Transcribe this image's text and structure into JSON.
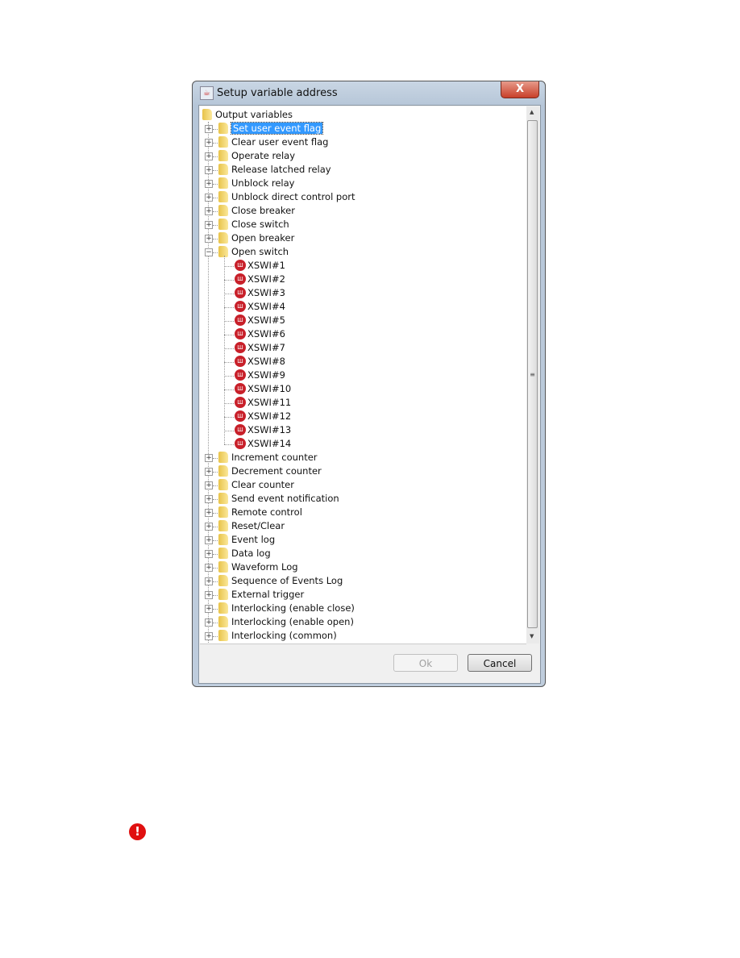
{
  "dialog": {
    "title": "Setup variable address",
    "close_label": "X",
    "ok_label": "Ok",
    "cancel_label": "Cancel"
  },
  "tree": {
    "root": "Output variables",
    "selected": "Set user event flag",
    "items_before": [
      "Set user event flag",
      "Clear user event flag",
      "Operate relay",
      "Release latched relay",
      "Unblock relay",
      "Unblock direct control port",
      "Close breaker",
      "Close switch",
      "Open breaker"
    ],
    "expanded": "Open switch",
    "expanded_children": [
      "XSWI#1",
      "XSWI#2",
      "XSWI#3",
      "XSWI#4",
      "XSWI#5",
      "XSWI#6",
      "XSWI#7",
      "XSWI#8",
      "XSWI#9",
      "XSWI#10",
      "XSWI#11",
      "XSWI#12",
      "XSWI#13",
      "XSWI#14"
    ],
    "items_after": [
      "Increment counter",
      "Decrement counter",
      "Clear counter",
      "Send event notification",
      "Remote control",
      "Reset/Clear",
      "Event log",
      "Data log",
      "Waveform Log",
      "Sequence of Events Log",
      "External trigger",
      "Interlocking (enable close)",
      "Interlocking (enable open)",
      "Interlocking (common)"
    ]
  },
  "colors": {
    "selection": "#3399ff",
    "warning": "#e01010"
  }
}
